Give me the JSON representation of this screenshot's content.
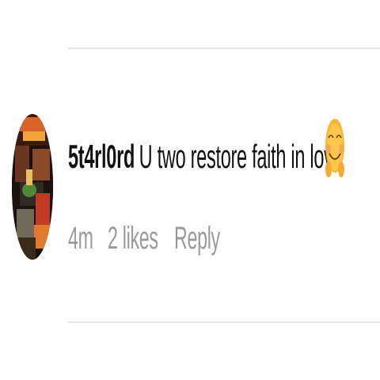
{
  "comment": {
    "username": "5t4rl0rd",
    "text": "U two restore faith in love",
    "emoji": "smiling-face-emoji"
  },
  "meta": {
    "time": "4m",
    "likes": "2 likes",
    "reply_label": "Reply"
  },
  "colors": {
    "text_primary": "#111111",
    "text_secondary": "#9a9a9a",
    "divider": "#e6e6e6",
    "emoji_yellow": "#f7b733"
  }
}
